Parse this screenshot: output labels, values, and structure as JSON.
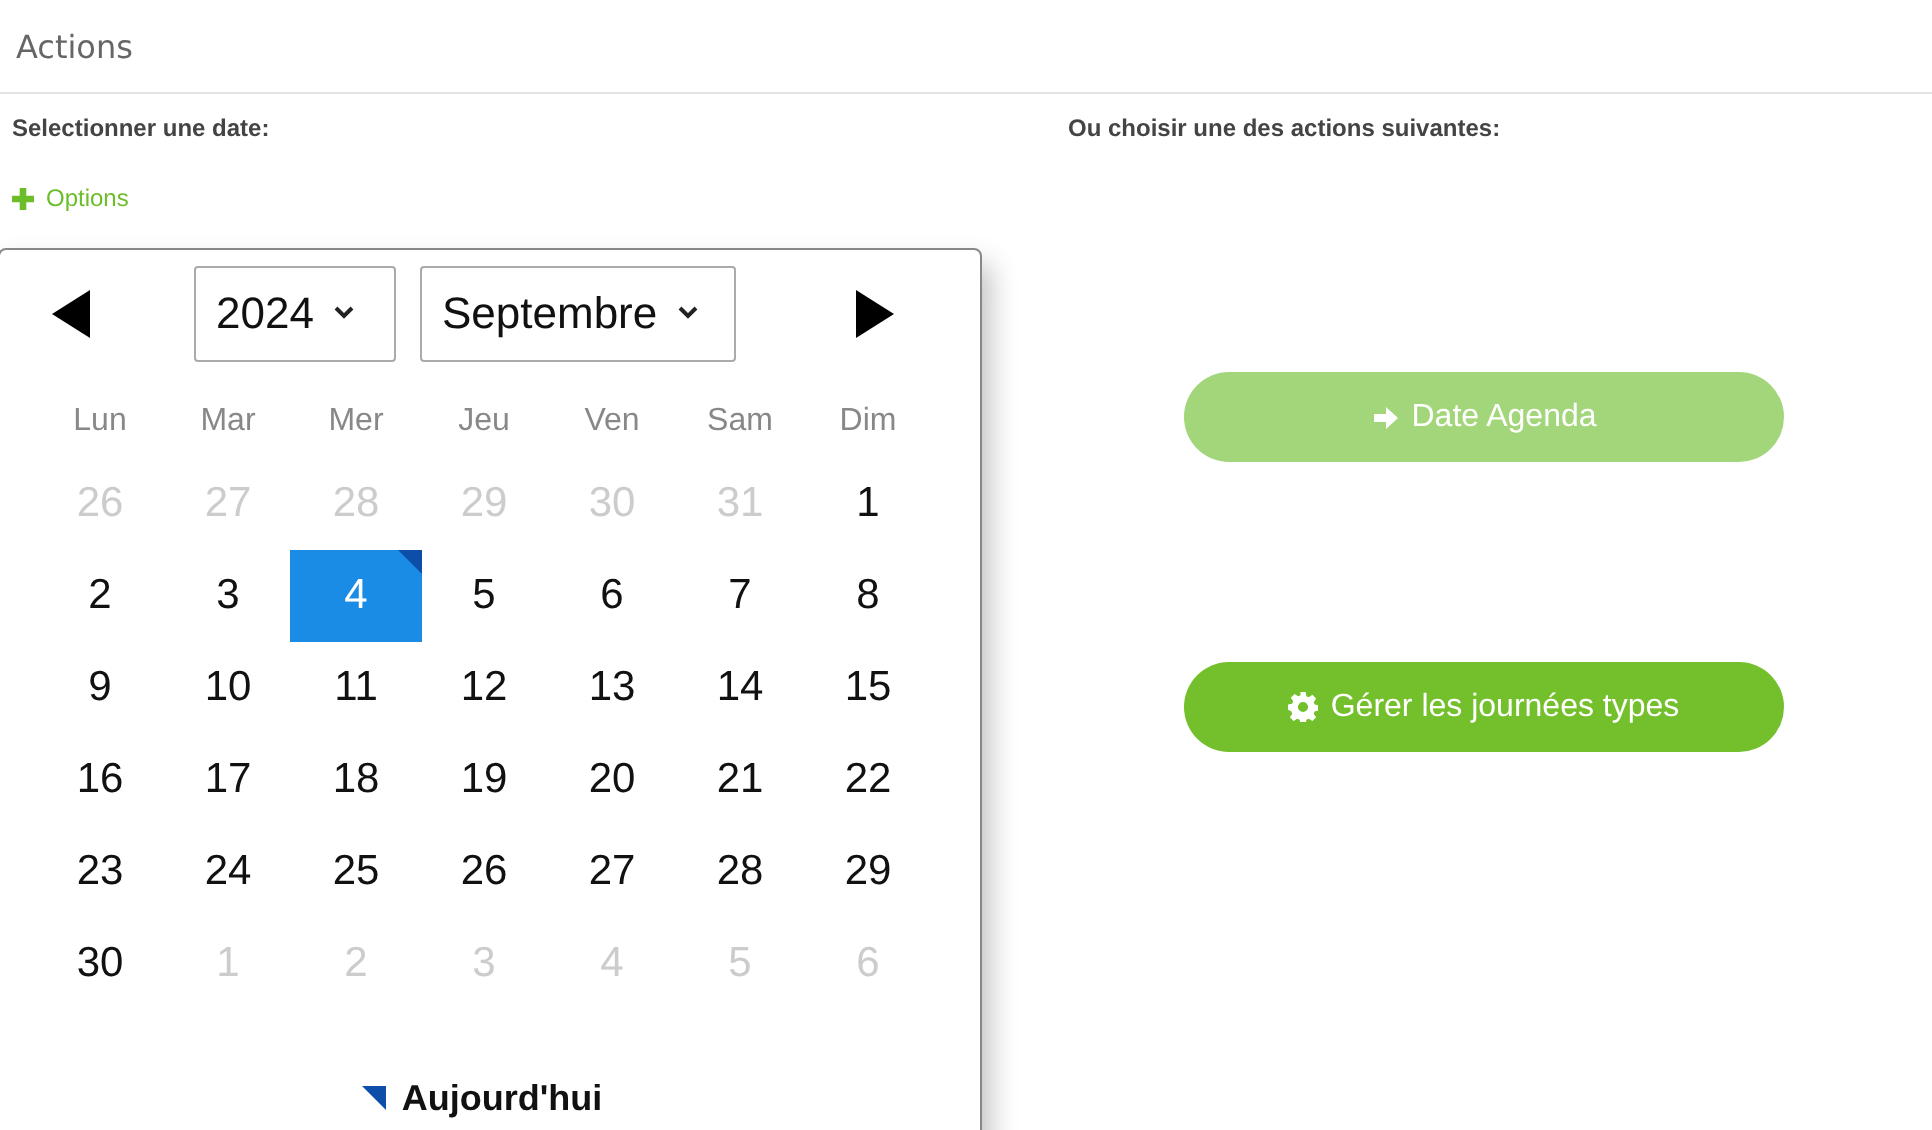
{
  "header": {
    "title": "Actions"
  },
  "left": {
    "label": "Selectionner une date:",
    "options_link": "Options"
  },
  "calendar": {
    "year": "2024",
    "month": "Septembre",
    "weekdays": [
      "Lun",
      "Mar",
      "Mer",
      "Jeu",
      "Ven",
      "Sam",
      "Dim"
    ],
    "weeks": [
      [
        {
          "day": "26",
          "outside": true,
          "selected": false,
          "today": false
        },
        {
          "day": "27",
          "outside": true,
          "selected": false,
          "today": false
        },
        {
          "day": "28",
          "outside": true,
          "selected": false,
          "today": false
        },
        {
          "day": "29",
          "outside": true,
          "selected": false,
          "today": false
        },
        {
          "day": "30",
          "outside": true,
          "selected": false,
          "today": false
        },
        {
          "day": "31",
          "outside": true,
          "selected": false,
          "today": false
        },
        {
          "day": "1",
          "outside": false,
          "selected": false,
          "today": false
        }
      ],
      [
        {
          "day": "2",
          "outside": false,
          "selected": false,
          "today": false
        },
        {
          "day": "3",
          "outside": false,
          "selected": false,
          "today": false
        },
        {
          "day": "4",
          "outside": false,
          "selected": true,
          "today": true
        },
        {
          "day": "5",
          "outside": false,
          "selected": false,
          "today": false
        },
        {
          "day": "6",
          "outside": false,
          "selected": false,
          "today": false
        },
        {
          "day": "7",
          "outside": false,
          "selected": false,
          "today": false
        },
        {
          "day": "8",
          "outside": false,
          "selected": false,
          "today": false
        }
      ],
      [
        {
          "day": "9",
          "outside": false,
          "selected": false,
          "today": false
        },
        {
          "day": "10",
          "outside": false,
          "selected": false,
          "today": false
        },
        {
          "day": "11",
          "outside": false,
          "selected": false,
          "today": false
        },
        {
          "day": "12",
          "outside": false,
          "selected": false,
          "today": false
        },
        {
          "day": "13",
          "outside": false,
          "selected": false,
          "today": false
        },
        {
          "day": "14",
          "outside": false,
          "selected": false,
          "today": false
        },
        {
          "day": "15",
          "outside": false,
          "selected": false,
          "today": false
        }
      ],
      [
        {
          "day": "16",
          "outside": false,
          "selected": false,
          "today": false
        },
        {
          "day": "17",
          "outside": false,
          "selected": false,
          "today": false
        },
        {
          "day": "18",
          "outside": false,
          "selected": false,
          "today": false
        },
        {
          "day": "19",
          "outside": false,
          "selected": false,
          "today": false
        },
        {
          "day": "20",
          "outside": false,
          "selected": false,
          "today": false
        },
        {
          "day": "21",
          "outside": false,
          "selected": false,
          "today": false
        },
        {
          "day": "22",
          "outside": false,
          "selected": false,
          "today": false
        }
      ],
      [
        {
          "day": "23",
          "outside": false,
          "selected": false,
          "today": false
        },
        {
          "day": "24",
          "outside": false,
          "selected": false,
          "today": false
        },
        {
          "day": "25",
          "outside": false,
          "selected": false,
          "today": false
        },
        {
          "day": "26",
          "outside": false,
          "selected": false,
          "today": false
        },
        {
          "day": "27",
          "outside": false,
          "selected": false,
          "today": false
        },
        {
          "day": "28",
          "outside": false,
          "selected": false,
          "today": false
        },
        {
          "day": "29",
          "outside": false,
          "selected": false,
          "today": false
        }
      ],
      [
        {
          "day": "30",
          "outside": false,
          "selected": false,
          "today": false
        },
        {
          "day": "1",
          "outside": true,
          "selected": false,
          "today": false
        },
        {
          "day": "2",
          "outside": true,
          "selected": false,
          "today": false
        },
        {
          "day": "3",
          "outside": true,
          "selected": false,
          "today": false
        },
        {
          "day": "4",
          "outside": true,
          "selected": false,
          "today": false
        },
        {
          "day": "5",
          "outside": true,
          "selected": false,
          "today": false
        },
        {
          "day": "6",
          "outside": true,
          "selected": false,
          "today": false
        }
      ]
    ],
    "legend": "Aujourd'hui"
  },
  "right": {
    "label": "Ou choisir une des actions suivantes:",
    "buttons": [
      {
        "kind": "arrow",
        "label": "Date Agenda",
        "disabled": true
      },
      {
        "kind": "gear",
        "label": "Gérer les journées types",
        "disabled": false
      }
    ]
  }
}
